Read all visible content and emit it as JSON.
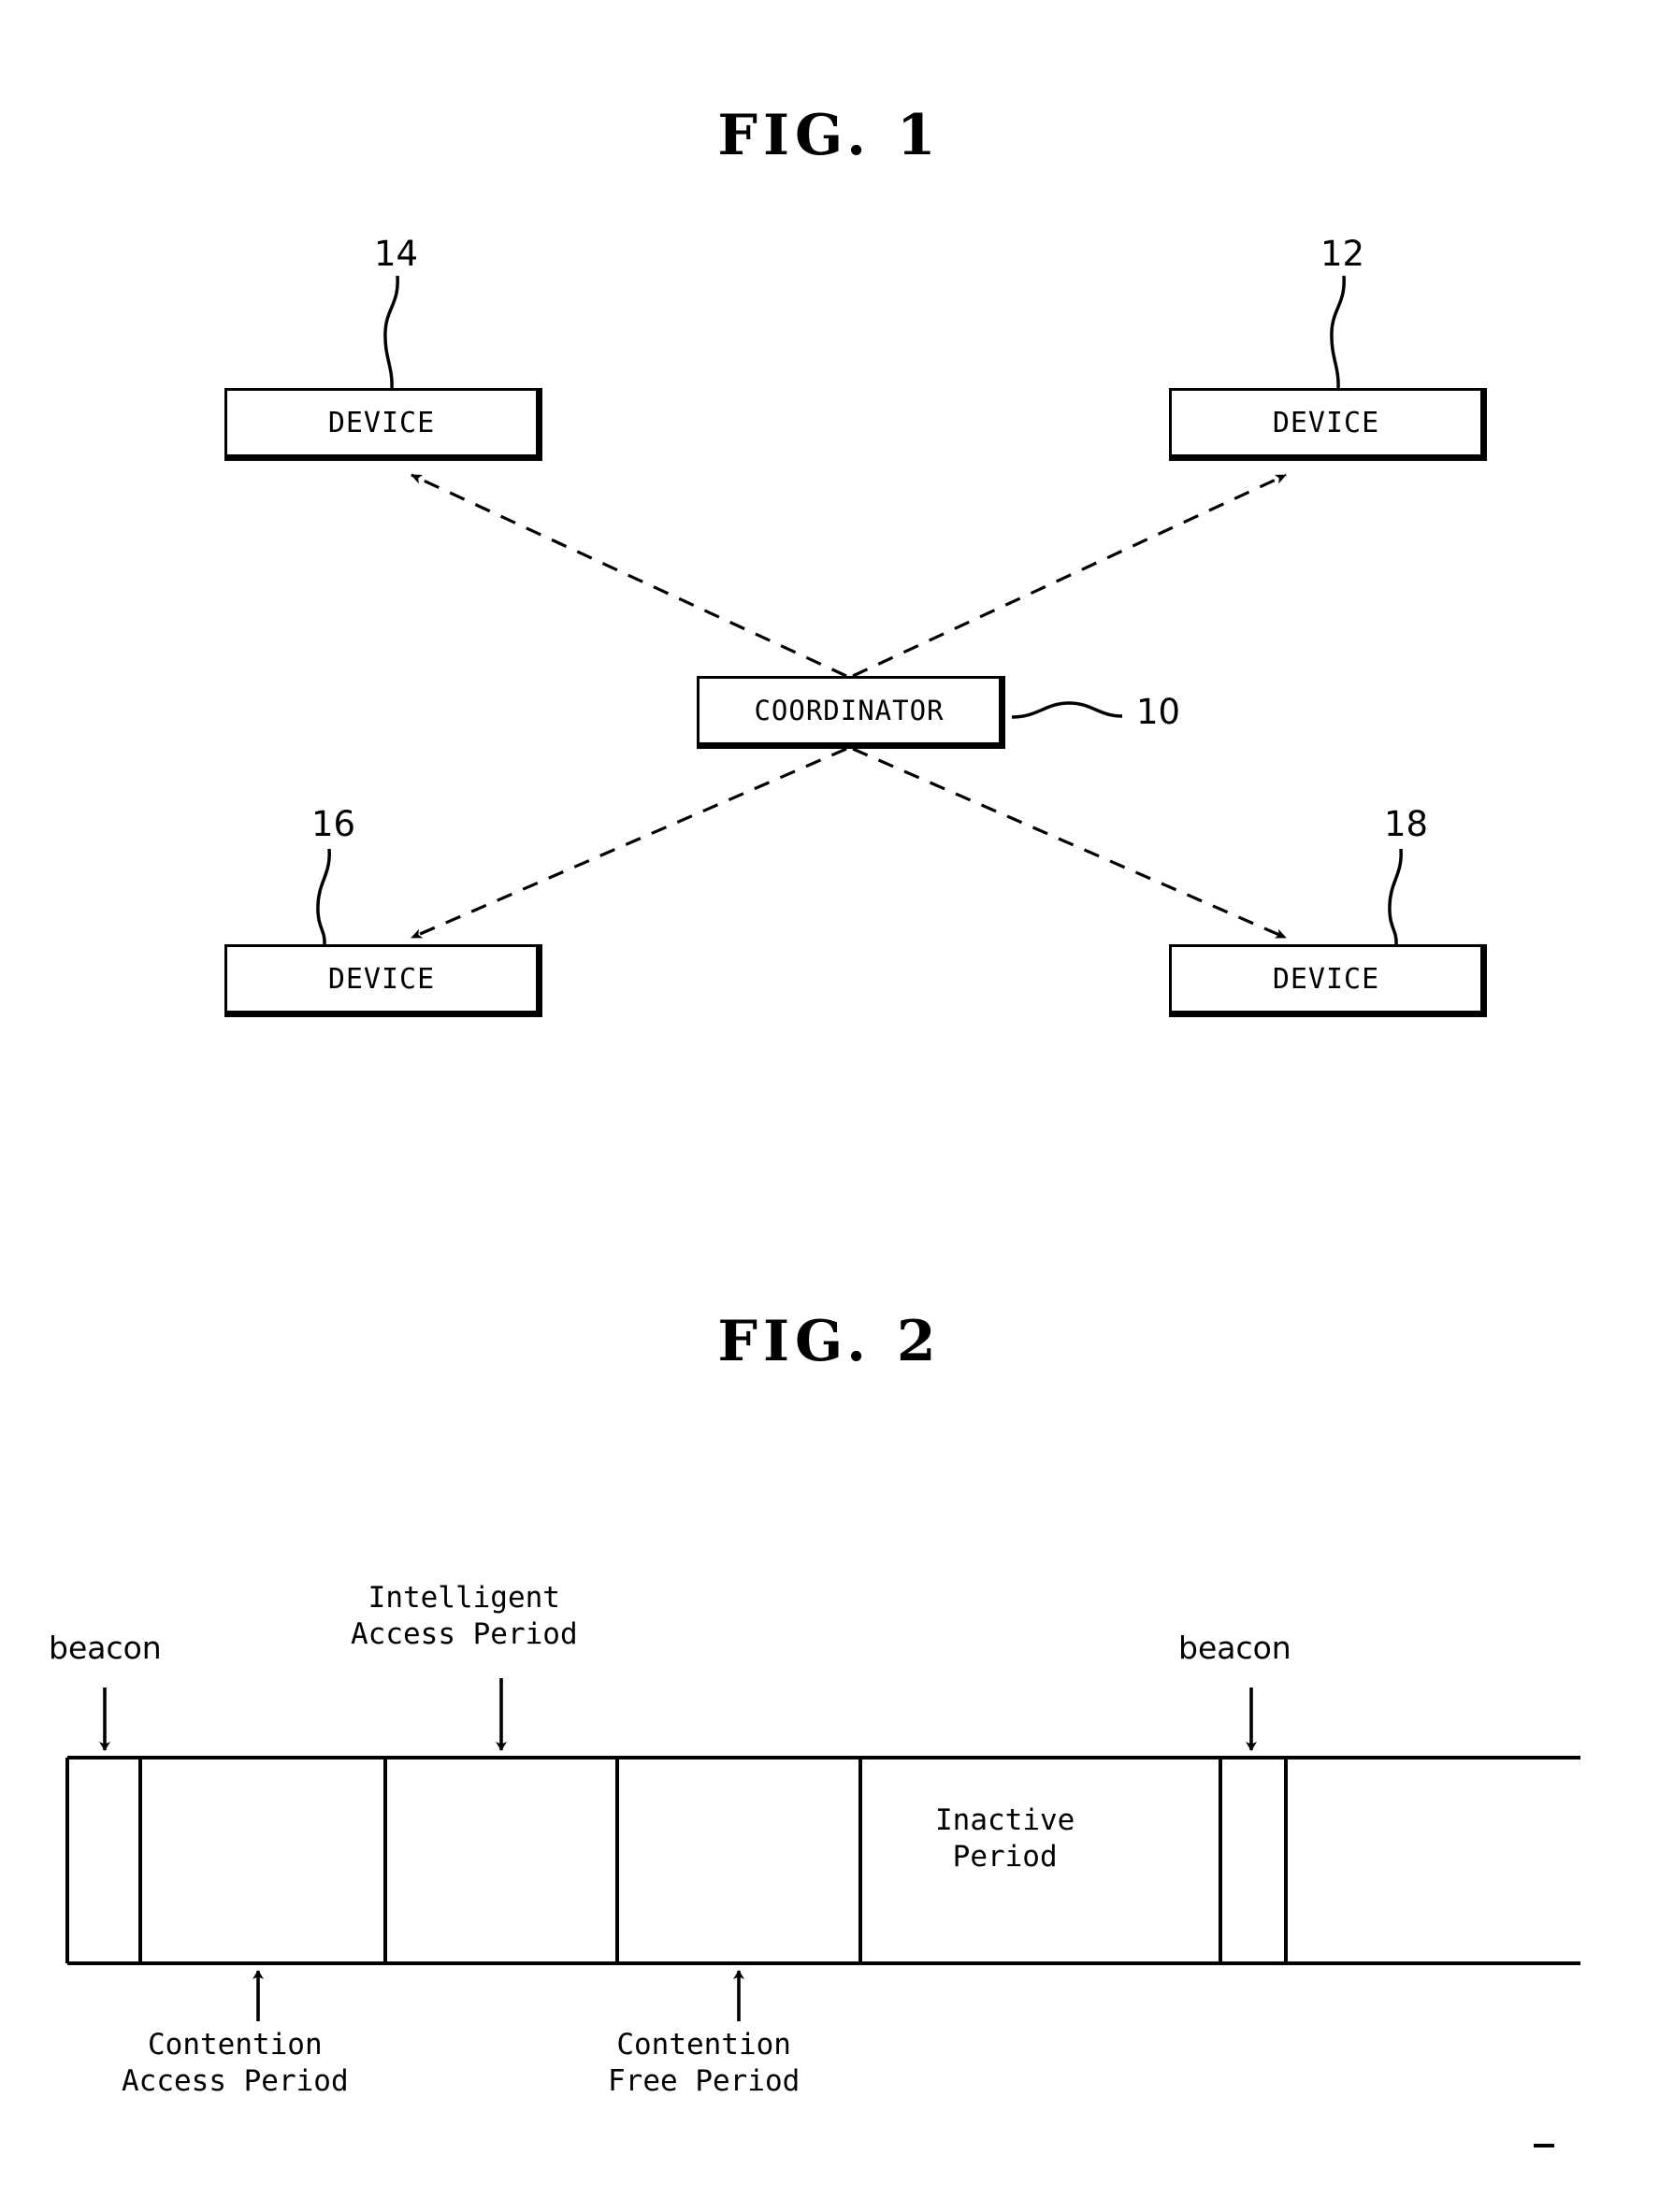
{
  "figures": [
    {
      "title": "FIG.  1",
      "nodes": [
        {
          "label": "DEVICE",
          "ref": "14"
        },
        {
          "label": "DEVICE",
          "ref": "12"
        },
        {
          "label": "COORDINATOR",
          "ref": "10"
        },
        {
          "label": "DEVICE",
          "ref": "16"
        },
        {
          "label": "DEVICE",
          "ref": "18"
        }
      ],
      "refs": {
        "r10": "10",
        "r12": "12",
        "r14": "14",
        "r16": "16",
        "r18": "18"
      }
    },
    {
      "title": "FIG.  2",
      "labels": {
        "beacon_left": "beacon",
        "beacon_right": "beacon",
        "intelligent_access_period": "Intelligent\nAccess Period",
        "inactive_period": "Inactive\nPeriod",
        "contention_access_period": "Contention\nAccess Period",
        "contention_free_period": "Contention\nFree Period"
      }
    }
  ],
  "fig1": {
    "title": "FIG.  1",
    "device_14": "DEVICE",
    "device_12": "DEVICE",
    "device_16": "DEVICE",
    "device_18": "DEVICE",
    "coordinator": "COORDINATOR",
    "ref_14": "14",
    "ref_12": "12",
    "ref_16": "16",
    "ref_18": "18",
    "ref_10": "10"
  },
  "fig2": {
    "title": "FIG.  2",
    "beacon_left": "beacon",
    "beacon_right": "beacon",
    "intelligent_access_period": "Intelligent\nAccess Period",
    "inactive_period": "Inactive\nPeriod",
    "contention_access_period": "Contention\nAccess Period",
    "contention_free_period": "Contention\nFree Period"
  },
  "colors": {
    "ink": "#000000",
    "paper": "#ffffff"
  }
}
